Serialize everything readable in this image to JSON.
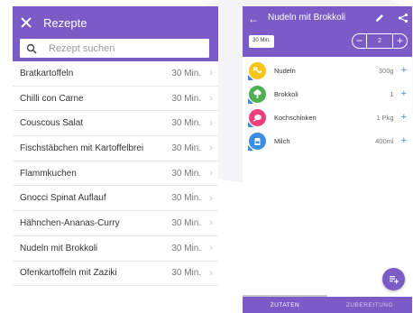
{
  "left_screen": {
    "title": "Rezepte",
    "search": {
      "placeholder": "Rezept suchen",
      "value": ""
    },
    "recipes": [
      {
        "name": "Bratkartoffeln",
        "time": "30 Min."
      },
      {
        "name": "Chilli con Carne",
        "time": "30 Min."
      },
      {
        "name": "Couscous Salat",
        "time": "30 Min."
      },
      {
        "name": "Fischstäbchen mit Kartoffelbrei",
        "time": "30 Min."
      },
      {
        "name": "Flammkuchen",
        "time": "30 Min."
      },
      {
        "name": "Gnocci Spinat Auflauf",
        "time": "30 Min."
      },
      {
        "name": "Hähnchen-Ananas-Curry",
        "time": "30 Min."
      },
      {
        "name": "Nudeln mit Brokkoli",
        "time": "30 Min."
      },
      {
        "name": "Ofenkartoffeln mit Zaziki",
        "time": "30 Min."
      }
    ],
    "chevron": "›"
  },
  "right_screen": {
    "title": "Nudeln mit Brokkoli",
    "time_chip": "30 Min.",
    "servings": {
      "minus": "−",
      "value": "2",
      "plus": "+"
    },
    "ingredients": [
      {
        "name": "Nudeln",
        "amount": "300g",
        "icon": "pasta-icon",
        "color": "#f5c518"
      },
      {
        "name": "Brokkoli",
        "amount": "1",
        "icon": "broccoli-icon",
        "color": "#4caf50"
      },
      {
        "name": "Kochschinken",
        "amount": "1 Pkg",
        "icon": "ham-icon",
        "color": "#ec407a"
      },
      {
        "name": "Milch",
        "amount": "400ml",
        "icon": "milk-icon",
        "color": "#3b8de0"
      }
    ],
    "add_symbol": "+",
    "tabs": [
      {
        "label": "ZUTATEN",
        "active": true
      },
      {
        "label": "ZUBEREITUNG",
        "active": false
      }
    ]
  },
  "colors": {
    "primary": "#7b5cc7",
    "accent_blue": "#3b8de0"
  }
}
